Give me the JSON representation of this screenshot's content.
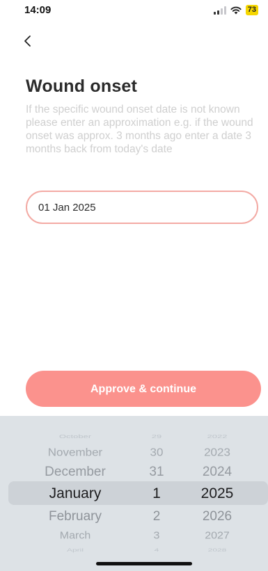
{
  "status_bar": {
    "time": "14:09",
    "battery": "73"
  },
  "page": {
    "title": "Wound onset",
    "helper_text": "If the specific wound onset date is not known please enter an approximation e.g. if the wound onset was approx. 3 months ago enter a date 3 months back from today's date",
    "date_value": "01 Jan 2025",
    "approve_label": "Approve & continue"
  },
  "picker": {
    "months": [
      "October",
      "November",
      "December",
      "January",
      "February",
      "March",
      "April"
    ],
    "days": [
      "29",
      "30",
      "31",
      "1",
      "2",
      "3",
      "4"
    ],
    "years": [
      "2022",
      "2023",
      "2024",
      "2025",
      "2026",
      "2027",
      "2028"
    ],
    "selected": {
      "month": "January",
      "day": "1",
      "year": "2025"
    }
  },
  "colors": {
    "accent": "#fb928d",
    "field_border": "#f3aaa4",
    "picker_bg": "#dde2e6"
  }
}
